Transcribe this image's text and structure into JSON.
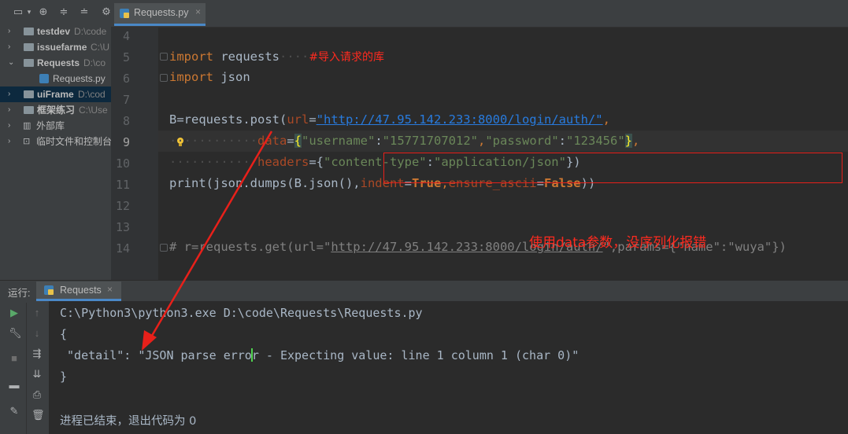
{
  "project": {
    "items": [
      {
        "name": "testdev",
        "path": "D:\\code",
        "bold": true,
        "arrow": "›"
      },
      {
        "name": "issuefarme",
        "path": "C:\\U",
        "bold": true,
        "arrow": "›"
      },
      {
        "name": "Requests",
        "path": "D:\\co",
        "bold": true,
        "arrow": "⌄"
      },
      {
        "name": "Requests.py",
        "path": "",
        "bold": false,
        "arrow": ""
      },
      {
        "name": "uiFrame",
        "path": "D:\\cod",
        "bold": true,
        "arrow": "›"
      },
      {
        "name": "框架练习",
        "path": "C:\\Use",
        "bold": true,
        "arrow": "›"
      },
      {
        "name": "外部库",
        "path": "",
        "bold": false,
        "arrow": "›"
      },
      {
        "name": "临时文件和控制台",
        "path": "",
        "bold": false,
        "arrow": "›"
      }
    ]
  },
  "editor": {
    "tab_label": "Requests.py",
    "tab_close": "×",
    "line_numbers": [
      "4",
      "5",
      "6",
      "7",
      "8",
      "9",
      "10",
      "11",
      "12",
      "13",
      "14"
    ],
    "code": {
      "l5_kw": "import",
      "l5_mod": " requests",
      "l5_comment": "#导入请求的库",
      "l6_kw": "import",
      "l6_mod": " json",
      "l8_a": "B=requests.post(",
      "l8_param": "url",
      "l8_eq": "=",
      "l8_url": "\"http://47.95.142.233:8000/login/auth/\"",
      "l8_comma": ",",
      "l9_param": "data",
      "l9_eq": "=",
      "l9_open": "{",
      "l9_k1": "\"username\"",
      "l9_c1": ":",
      "l9_v1": "\"15771707012\"",
      "l9_comma": ",",
      "l9_k2": "\"password\"",
      "l9_c2": ":",
      "l9_v2": "\"123456\"",
      "l9_close": "}",
      "l9_end": ",",
      "l10_param": "headers",
      "l10_eq": "={",
      "l10_k": "\"content-type\"",
      "l10_c": ":",
      "l10_v": "\"application/json\"",
      "l10_end": "})",
      "l11_a": "print(json.dumps(B.json(),",
      "l11_p1": "indent",
      "l11_eq1": "=",
      "l11_v1": "True",
      "l11_comma": ",",
      "l11_p2": "ensure_ascii",
      "l11_eq2": "=",
      "l11_v2": "False",
      "l11_end": "))",
      "l14_a": "# r=requests.get(url=\"",
      "l14_url": "http://47.95.142.233:8000/login/auth/",
      "l14_b": "\",params={\"name\":\"wuya\"})"
    },
    "annotation": "使用data参数，没序列化报错"
  },
  "run": {
    "panel_label": "运行:",
    "tab_label": "Requests",
    "tab_close": "×",
    "console": {
      "cmd": "C:\\Python3\\python3.exe D:\\code\\Requests\\Requests.py",
      "open": "{",
      "detail_a": " \"detail\": \"JSON parse erro",
      "detail_b": "r - Expecting value: line 1 column 1 (char 0)\"",
      "close": "}",
      "exit": "进程已结束，退出代码为 0"
    }
  },
  "colors": {
    "annotation": "#ff2a1f",
    "keyword": "#cc7832",
    "string": "#6a8759",
    "url": "#287bde"
  }
}
